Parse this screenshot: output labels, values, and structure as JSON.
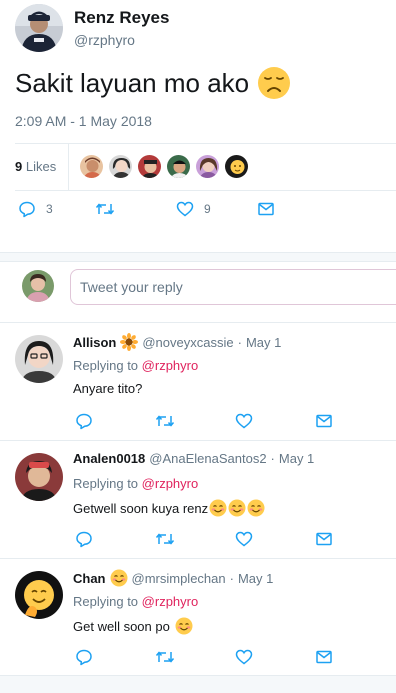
{
  "main_tweet": {
    "author_name": "Renz Reyes",
    "author_handle": "@rzphyro",
    "text": "Sakit layuan mo ako",
    "emoji": "disappointed-face",
    "timestamp": "2:09 AM - 1 May 2018",
    "likes_count": "9",
    "likes_label": "Likes",
    "liker_avatar_count": 6,
    "reply_count": "3",
    "retweet_count": "",
    "like_count": "9"
  },
  "composer": {
    "placeholder": "Tweet your reply"
  },
  "replies": [
    {
      "name": "Allison",
      "name_emoji": "sunflower",
      "handle": "@noveyxcassie",
      "separator": "·",
      "date": "May 1",
      "replying_prefix": "Replying to",
      "replying_to": "@rzphyro",
      "text": "Anyare tito?",
      "trailing_emoji_count": 0
    },
    {
      "name": "Analen0018",
      "name_emoji": "",
      "handle": "@AnaElenaSantos2",
      "separator": "·",
      "date": "May 1",
      "replying_prefix": "Replying to",
      "replying_to": "@rzphyro",
      "text": "Getwell soon kuya renz",
      "trailing_emoji_count": 3
    },
    {
      "name": "Chan",
      "name_emoji": "smiling-face",
      "handle": "@mrsimplechan",
      "separator": "·",
      "date": "May 1",
      "replying_prefix": "Replying to",
      "replying_to": "@rzphyro",
      "text": "Get well soon po",
      "trailing_emoji_count": 1
    }
  ],
  "colors": {
    "text_primary": "#14171a",
    "text_secondary": "#657786",
    "link_accent": "#e0245e",
    "icon": "#1da1f2",
    "divider": "#e6ecf0"
  },
  "icons": {
    "reply": "reply-icon",
    "retweet": "retweet-icon",
    "like": "heart-icon",
    "message": "envelope-icon"
  }
}
